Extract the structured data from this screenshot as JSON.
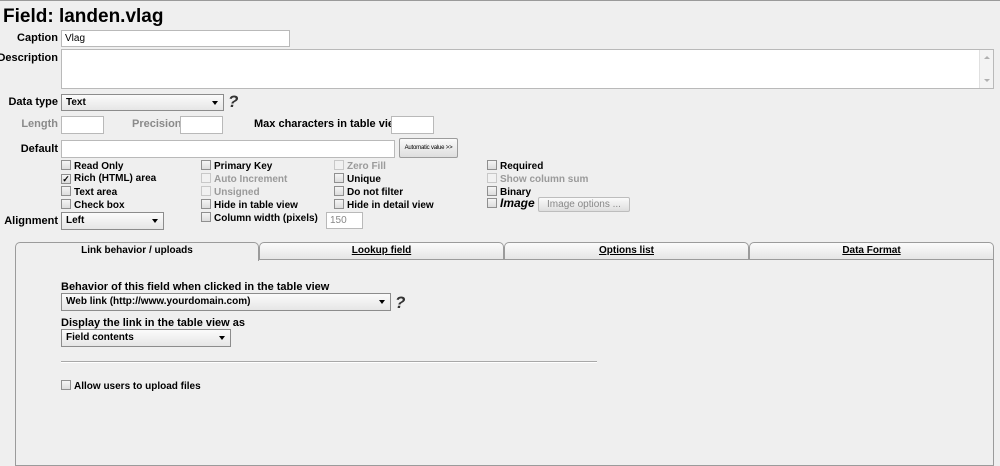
{
  "page": {
    "title": "Field: landen.vlag"
  },
  "caption": {
    "label": "Caption",
    "value": "Vlag"
  },
  "description": {
    "label": "Description",
    "value": ""
  },
  "data_type": {
    "label": "Data type",
    "value": "Text",
    "help": "?"
  },
  "length": {
    "label": "Length",
    "value": ""
  },
  "precision": {
    "label": "Precision",
    "value": ""
  },
  "max_chars": {
    "label": "Max characters in table view",
    "value": ""
  },
  "default": {
    "label": "Default",
    "value": "",
    "auto_button": "Automatic value >>"
  },
  "checkboxes": {
    "read_only": {
      "label": "Read Only",
      "checked": false
    },
    "rich_html": {
      "label": "Rich (HTML) area",
      "checked": true
    },
    "text_area": {
      "label": "Text area",
      "checked": false
    },
    "check_box": {
      "label": "Check box",
      "checked": false
    },
    "primary_key": {
      "label": "Primary Key",
      "checked": false
    },
    "auto_increment": {
      "label": "Auto Increment",
      "checked": false
    },
    "unsigned": {
      "label": "Unsigned",
      "checked": false
    },
    "hide_in_table": {
      "label": "Hide in table view",
      "checked": false
    },
    "column_width": {
      "label": "Column width (pixels)",
      "checked": false,
      "value": "150"
    },
    "zero_fill": {
      "label": "Zero Fill",
      "checked": false
    },
    "unique": {
      "label": "Unique",
      "checked": false
    },
    "do_not_filter": {
      "label": "Do not filter",
      "checked": false
    },
    "hide_in_detail": {
      "label": "Hide in detail view",
      "checked": false
    },
    "required": {
      "label": "Required",
      "checked": false
    },
    "show_column_sum": {
      "label": "Show column sum",
      "checked": false
    },
    "binary": {
      "label": "Binary",
      "checked": false
    },
    "image": {
      "label": "Image",
      "checked": false,
      "options_button": "Image options ..."
    }
  },
  "alignment": {
    "label": "Alignment",
    "value": "Left"
  },
  "tabs": [
    {
      "label": "Link behavior / uploads",
      "active": true
    },
    {
      "label": "Lookup field",
      "active": false
    },
    {
      "label": "Options list",
      "active": false
    },
    {
      "label": "Data Format",
      "active": false
    }
  ],
  "link_tab": {
    "behavior_label": "Behavior of this field when clicked in the table view",
    "behavior_value": "Web link (http://www.yourdomain.com)",
    "help": "?",
    "display_label": "Display the link in the table view as",
    "display_value": "Field contents",
    "allow_upload": {
      "label": "Allow users to upload files",
      "checked": false
    }
  },
  "colors": {
    "background": "#efefef",
    "border": "#9b9b9b",
    "disabled_text": "#8a8a8a"
  }
}
